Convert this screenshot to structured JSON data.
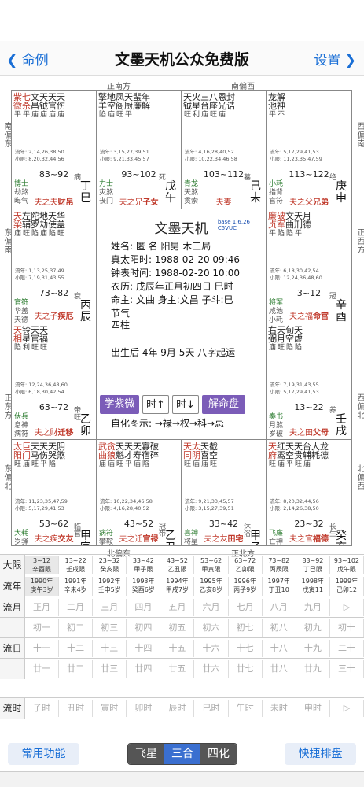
{
  "nav": {
    "back": "❮ 命例",
    "title": "文墨天机公众免费版",
    "settings": "设置 ❯"
  },
  "dirs": {
    "top_left": "正南方",
    "top_right": "南偏西",
    "bottom_left": "北偏东",
    "bottom_right": "正北方",
    "left_top": "南偏东",
    "left_mid_top": "东偏南",
    "left_mid_bottom": "正东方",
    "left_bottom": "东偏北",
    "right_top": "西偏南",
    "right_mid_top": "正西方",
    "right_mid_bottom": "西偏北",
    "right_bottom": "北偏西"
  },
  "cells": [
    {
      "id": "si",
      "stars": [
        [
          "紫微",
          "平"
        ],
        [
          "七杀",
          "平"
        ],
        [
          "文昌",
          "庙"
        ],
        [
          "天钺",
          "庙"
        ],
        [
          "天官",
          "庙"
        ],
        [
          "天伤",
          "庙"
        ]
      ],
      "small": "擎 地 凤 天 蜚 年\n羊 空 阁 厨 廉 解",
      "age": "流年: 2,14,26,38,50\n小限: 8,20,32,44,56",
      "range": "83~92",
      "cs": "病",
      "left": [
        "博士",
        "劫煞",
        "晦气"
      ],
      "gz": [
        "丁",
        "巳"
      ],
      "dx": "夫之夫",
      "pn": "财帛"
    },
    {
      "id": "wu",
      "stars": [
        [
          "擎羊",
          "陷"
        ],
        [
          "地空",
          "庙"
        ],
        [
          "凤阁",
          "旺"
        ],
        [
          "天厨",
          "平"
        ],
        [
          "蜚廉",
          ""
        ],
        [
          "年解",
          ""
        ]
      ],
      "age": "流年: 3,15,27,39,51\n小限: 9,21,33,45,57",
      "range": "93~102",
      "cs": "死",
      "left": [
        "力士",
        "灾煞",
        "丧门"
      ],
      "gz": [
        "戊",
        "午"
      ],
      "dx": "夫之兄",
      "pn": "子女"
    },
    {
      "id": "wei",
      "stars": [
        [
          "天钺",
          "旺"
        ],
        [
          "火星",
          "利"
        ],
        [
          "三台",
          "庙"
        ],
        [
          "八座",
          "旺"
        ],
        [
          "恩光",
          "庙"
        ],
        [
          "封诰",
          ""
        ]
      ],
      "age": "流年: 4,16,28,40,52\n小限: 10,22,34,46,58",
      "range": "103~112",
      "cs": "墓",
      "left": [
        "青龙",
        "天煞",
        "贯索"
      ],
      "gz": [
        "己",
        "未"
      ],
      "dx": "夫妻",
      "pn": ""
    },
    {
      "id": "shen",
      "stars": [
        [
          "龙池",
          "平"
        ],
        [
          "解神",
          "不"
        ]
      ],
      "age": "流年: 5,17,29,41,53\n小限: 11,23,35,47,59",
      "range": "113~122",
      "cs": "绝",
      "left": [
        "小耗",
        "指背",
        "官符"
      ],
      "gz": [
        "庚",
        "申"
      ],
      "dx": "夫之父",
      "pn": "兄弟"
    },
    {
      "id": "chen",
      "stars": [
        [
          "天梁",
          "庙"
        ],
        [
          "左辅",
          "旺"
        ],
        [
          "陀罗",
          "陷"
        ],
        [
          "地劫",
          "庙"
        ],
        [
          "天使",
          "陷"
        ],
        [
          "华盖",
          "旺"
        ]
      ],
      "age": "流年: 1,13,25,37,49\n小限: 7,19,31,43,55",
      "range": "73~82",
      "cs": "衰",
      "left": [
        "官符",
        "华盖",
        "天德"
      ],
      "gz": [
        "丙",
        "辰"
      ],
      "dx": "夫之子",
      "pn": "疾厄"
    },
    {
      "id": "you",
      "stars": [
        [
          "廉贞",
          "平"
        ],
        [
          "破军",
          "陷"
        ],
        [
          "文曲",
          "陷"
        ],
        [
          "天刑",
          "平"
        ],
        [
          "月德",
          ""
        ]
      ],
      "age": "流年: 6,18,30,42,54\n小限: 12,24,36,48,60",
      "range": "3~12",
      "cs": "冠",
      "left": [
        "将军",
        "咸池",
        "小耗"
      ],
      "gz": [
        "辛",
        "酉"
      ],
      "dx": "夫之福",
      "pn": "命宫"
    },
    {
      "id": "mao",
      "stars": [
        [
          "天相",
          "陷"
        ],
        [
          "铃星",
          "利"
        ],
        [
          "天官",
          "旺"
        ],
        [
          "天福",
          "旺"
        ]
      ],
      "age": "流年: 12,24,36,48,60\n小限: 6,18,30,42,54",
      "range": "63~72",
      "cs": "帝旺",
      "left": [
        "伏兵",
        "息神",
        "病符"
      ],
      "gz": [
        "乙",
        "卯"
      ],
      "dx": "夫之财",
      "pn": "迁移"
    },
    {
      "id": "xu",
      "stars": [
        [
          "右弼",
          "庙"
        ],
        [
          "天月",
          "旺"
        ],
        [
          "旬空",
          "陷"
        ],
        [
          "天虚",
          "陷"
        ]
      ],
      "age": "流年: 7,19,31,43,55\n小限: 5,17,29,41,53",
      "range": "13~22",
      "cs": "养",
      "left": [
        "奏书",
        "月煞",
        "岁破"
      ],
      "gz": [
        "壬",
        "戌"
      ],
      "dx": "夫之田",
      "pn": "父母"
    },
    {
      "id": "yin",
      "stars": [
        [
          "太阳",
          "旺"
        ],
        [
          "巨门",
          "庙"
        ],
        [
          "天马",
          "旺"
        ],
        [
          "天伤",
          "平"
        ],
        [
          "天哭",
          "陷"
        ],
        [
          "阴煞",
          ""
        ]
      ],
      "age": "流年: 11,23,35,47,59\n小限: 5,17,29,41,53",
      "range": "53~62",
      "cs": "临官",
      "left": [
        "大耗",
        "岁驿",
        "吊客"
      ],
      "gz": [
        "甲",
        "寅"
      ],
      "dx": "夫之疾",
      "pn": "交友"
    },
    {
      "id": "chou",
      "stars": [
        [
          "武曲",
          "庙"
        ],
        [
          "贪狼",
          "庙"
        ],
        [
          "天魁",
          "旺"
        ],
        [
          "天才",
          "平"
        ],
        [
          "天寿",
          "庙"
        ],
        [
          "寡宿",
          "陷"
        ],
        [
          "破碎",
          ""
        ]
      ],
      "age": "流年: 10,22,34,46,58\n小限: 4,16,28,40,52",
      "range": "43~52",
      "cs": "冠带",
      "left": [
        "病符",
        "攀鞍",
        "天德"
      ],
      "gz": [
        "乙",
        "丑"
      ],
      "dx": "夫之迁",
      "pn": "官禄"
    },
    {
      "id": "zi",
      "stars": [
        [
          "天同",
          "旺"
        ],
        [
          "太阴",
          "庙"
        ],
        [
          "天喜",
          "庙"
        ],
        [
          "截空",
          "旺"
        ]
      ],
      "age": "流年: 9,21,33,45,57\n小限: 3,15,27,39,51",
      "range": "33~42",
      "cs": "沐浴",
      "left": [
        "喜神",
        "将星",
        "白虎"
      ],
      "gz": [
        "甲",
        "子"
      ],
      "dx": "夫之友",
      "pn": "田宅"
    },
    {
      "id": "hai",
      "stars": [
        [
          "天府",
          "旺"
        ],
        [
          "红鸾",
          "庙"
        ],
        [
          "天空",
          "平"
        ],
        [
          "天贵",
          "旺"
        ],
        [
          "台辅",
          "庙"
        ],
        [
          "大耗",
          ""
        ],
        [
          "龙德",
          ""
        ]
      ],
      "age": "流年: 8,20,32,44,56\n小限: 2,14,26,38,50",
      "range": "23~32",
      "cs": "长生",
      "left": [
        "飞廉",
        "亡神",
        "龙德"
      ],
      "gz": [
        "癸",
        "亥"
      ],
      "dx": "夫之官",
      "pn": "福德"
    }
  ],
  "center": {
    "title": "文墨天机",
    "base": "base 1.6.26\nC5VUC",
    "name": "姓名: 匿 名          阳男 木三局",
    "true_solar": "真太阳时: 1988-02-20 09:46",
    "clock": "钟表时间: 1988-02-20 10:00",
    "lunar": "农历: 戊辰年正月初四日 巳时",
    "ming": "命主: 文曲 身主:文昌 子斗:巳",
    "jieqi": "节气",
    "sizhu": "四柱",
    "qiyun": "出生后 4年 9月 5天 八字起运",
    "zihua": "自化图示: →禄→权→科→忌",
    "buttons": {
      "ziwei": "学紫微",
      "time_up": "时↑",
      "time_down": "时↓",
      "jiemi": "解命盘"
    }
  },
  "grid": {
    "daxian_label": "大限",
    "daxian": [
      "3~12\n辛酉限",
      "13~22\n壬戌限",
      "23~32\n癸亥限",
      "33~42\n甲子限",
      "43~52\n乙丑限",
      "53~62\n甲寅限",
      "63~72\n乙卯限",
      "73~82\n丙辰限",
      "83~92\n丁巳限",
      "93~102\n戊午限"
    ],
    "liunian_label": "流年",
    "liunian": [
      "1990年\n庚午3岁",
      "1991年\n辛未4岁",
      "1992年\n壬申5岁",
      "1993年\n癸酉6岁",
      "1994年\n甲戌7岁",
      "1995年\n乙亥8岁",
      "1996年\n丙子9岁",
      "1997年\n丁丑10",
      "1998年\n戊寅11",
      "1999年\n己卯12"
    ],
    "liuyue_label": "流月",
    "liuyue": [
      "正月",
      "二月",
      "三月",
      "四月",
      "五月",
      "六月",
      "七月",
      "八月",
      "九月",
      "▷"
    ],
    "liuri_label": "流日",
    "liuri1": [
      "初一",
      "初二",
      "初三",
      "初四",
      "初五",
      "初六",
      "初七",
      "初八",
      "初九",
      "初十"
    ],
    "liuri2": [
      "十一",
      "十二",
      "十三",
      "十四",
      "十五",
      "十六",
      "十七",
      "十八",
      "十九",
      "二十"
    ],
    "liuri3": [
      "廿一",
      "廿二",
      "廿三",
      "廿四",
      "廿五",
      "廿六",
      "廿七",
      "廿八",
      "廿九",
      "三十"
    ],
    "liushi_label": "流时",
    "liushi": [
      "子时",
      "丑时",
      "寅时",
      "卯时",
      "辰时",
      "巳时",
      "午时",
      "未时",
      "申时",
      "▷"
    ]
  },
  "bottom": {
    "left": "常用功能",
    "seg": [
      "飞星",
      "三合",
      "四化"
    ],
    "right": "快捷排盘"
  }
}
